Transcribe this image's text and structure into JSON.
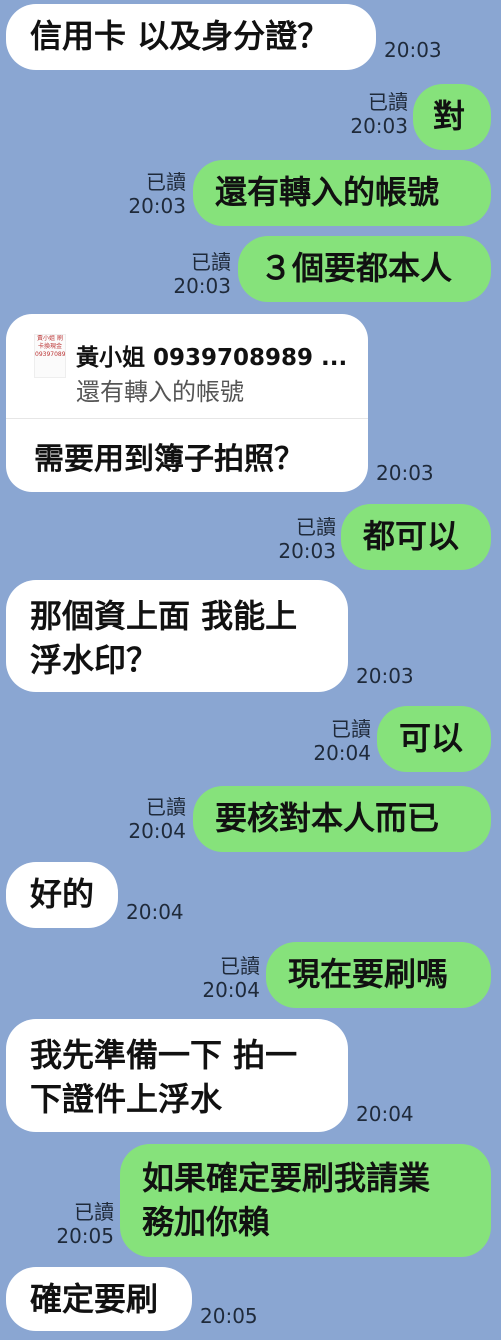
{
  "read_label": "已讀",
  "messages": [
    {
      "id": "m1",
      "side": "in",
      "text": "信用卡 以及身分證？",
      "time": "20:03"
    },
    {
      "id": "m2",
      "side": "out",
      "text": "對",
      "time": "20:03",
      "read": true
    },
    {
      "id": "m3",
      "side": "out",
      "text": "還有轉入的帳號",
      "time": "20:03",
      "read": true
    },
    {
      "id": "m4",
      "side": "out",
      "text": "３個要都本人",
      "time": "20:03",
      "read": true
    },
    {
      "id": "m5",
      "side": "in",
      "time": "20:03",
      "quote": {
        "author": "黃小姐 0939708989 ...",
        "text": "還有轉入的帳號",
        "thumb": "黃小姐 刷卡換現金 0939708989"
      },
      "text": "需要用到簿子拍照？"
    },
    {
      "id": "m6",
      "side": "out",
      "text": "都可以",
      "time": "20:03",
      "read": true
    },
    {
      "id": "m7",
      "side": "in",
      "text_lines": [
        "那個資上面 我能上",
        "浮水印？"
      ],
      "time": "20:03"
    },
    {
      "id": "m8",
      "side": "out",
      "text": "可以",
      "time": "20:04",
      "read": true
    },
    {
      "id": "m9",
      "side": "out",
      "text": "要核對本人而已",
      "time": "20:04",
      "read": true
    },
    {
      "id": "m10",
      "side": "in",
      "text": "好的",
      "time": "20:04"
    },
    {
      "id": "m11",
      "side": "out",
      "text": "現在要刷嗎",
      "time": "20:04",
      "read": true
    },
    {
      "id": "m12",
      "side": "in",
      "text_lines": [
        "我先準備一下 拍一",
        "下證件上浮水"
      ],
      "time": "20:04"
    },
    {
      "id": "m13",
      "side": "out",
      "text_lines": [
        "如果確定要刷我請業",
        "務加你賴"
      ],
      "time": "20:05",
      "read": true
    },
    {
      "id": "m14",
      "side": "in",
      "text": "確定要刷",
      "time": "20:05"
    }
  ]
}
